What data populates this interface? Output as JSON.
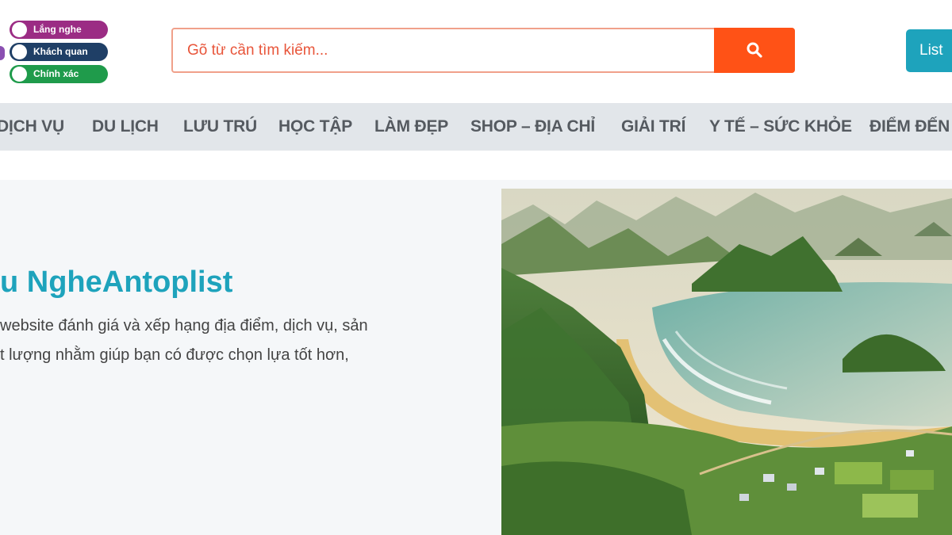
{
  "header": {
    "badges": [
      {
        "label": "Lắng nghe",
        "color": "#9b2c84"
      },
      {
        "label": "Khách quan",
        "color": "#1f3f66"
      },
      {
        "label": "Chính xác",
        "color": "#1f9b4b"
      }
    ],
    "search": {
      "placeholder": "Gõ từ cần tìm kiếm...",
      "button_icon": "search-icon"
    },
    "list_button_label": "List"
  },
  "nav": {
    "items": [
      {
        "label": "DỊCH VỤ"
      },
      {
        "label": "DU LỊCH"
      },
      {
        "label": "LƯU TRÚ"
      },
      {
        "label": "HỌC TẬP"
      },
      {
        "label": "LÀM ĐẸP"
      },
      {
        "label": "SHOP – ĐỊA CHỈ"
      },
      {
        "label": "GIẢI TRÍ"
      },
      {
        "label": "Y TẾ – SỨC KHỎE"
      },
      {
        "label": "ĐIỂM ĐẾN"
      }
    ]
  },
  "hero": {
    "title": "u NgheAntoplist",
    "desc_lines": [
      " website đánh giá và xếp hạng địa điểm, dịch vụ, sản",
      "t lượng nhằm giúp bạn có được chọn lựa tốt hơn,"
    ],
    "image_subject": "coastal-landscape-illustration"
  },
  "colors": {
    "accent": "#1ea3bc",
    "search_button": "#ff5216",
    "nav_background": "#e2e6ea"
  }
}
